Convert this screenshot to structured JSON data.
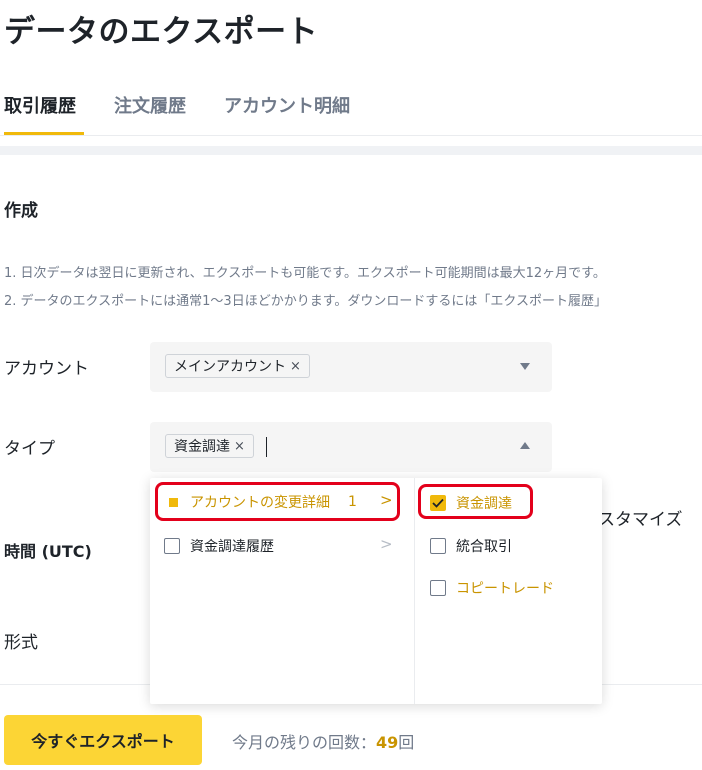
{
  "page": {
    "title": "データのエクスポート"
  },
  "tabs": [
    {
      "label": "取引履歴",
      "active": true
    },
    {
      "label": "注文履歴",
      "active": false
    },
    {
      "label": "アカウント明細",
      "active": false
    }
  ],
  "section": {
    "title": "作成",
    "notes": [
      "1.  日次データは翌日に更新され、エクスポートも可能です。エクスポート可能期間は最大12ヶ月です。",
      "2.  データのエクスポートには通常1～3日ほどかかります。ダウンロードするには「エクスポート履歴」"
    ]
  },
  "form": {
    "account": {
      "label": "アカウント",
      "tag": "メインアカウント",
      "remove": "×"
    },
    "type": {
      "label": "タイプ",
      "tag": "資金調達",
      "remove": "×"
    },
    "time": {
      "label": "時間 (UTC)",
      "customize_partial": "スタマイズ"
    },
    "format": {
      "label": "形式"
    }
  },
  "dropdown": {
    "left": [
      {
        "label": "アカウントの変更詳細",
        "count": "1",
        "arrow": ">",
        "selected": true
      },
      {
        "label": "資金調達履歴",
        "arrow": ">",
        "selected": false
      }
    ],
    "right": [
      {
        "label": "資金調達",
        "checked": true
      },
      {
        "label": "統合取引",
        "checked": false
      },
      {
        "label": "コピートレード",
        "checked": false
      }
    ]
  },
  "footer": {
    "export_button": "今すぐエクスポート",
    "remaining_prefix": "今月の残りの回数：",
    "remaining_count": "49",
    "remaining_suffix": "回"
  },
  "colors": {
    "accent": "#f0b90b",
    "button": "#fcd535",
    "highlight": "#e3001b",
    "text_muted": "#707a8a"
  }
}
